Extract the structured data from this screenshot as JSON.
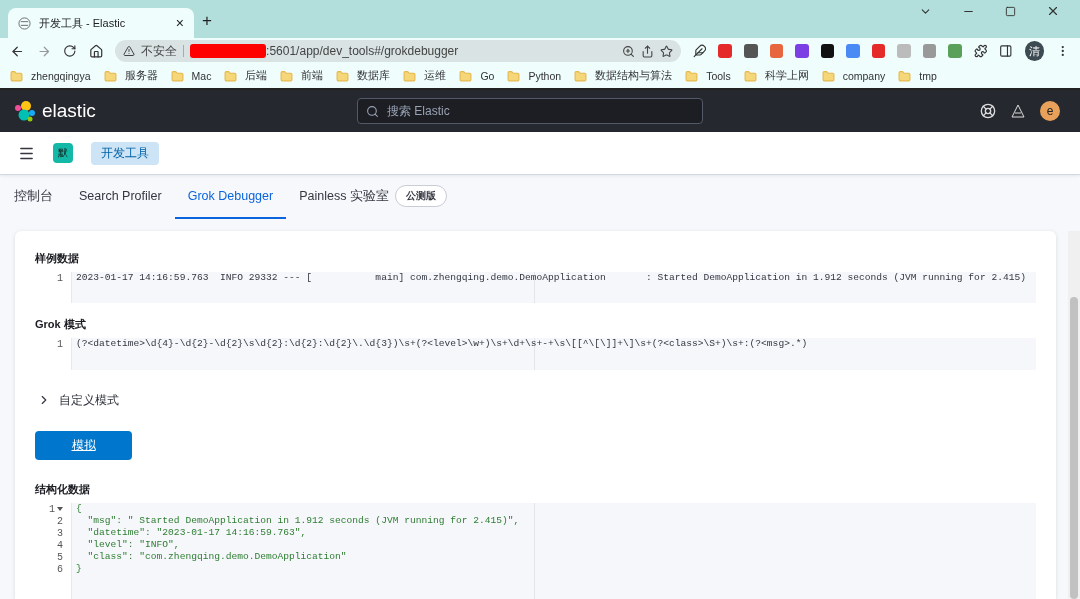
{
  "browser": {
    "tab": {
      "title": "开发工具 - Elastic",
      "close": "×"
    },
    "new_tab": "+",
    "address": {
      "security": "不安全",
      "redacted": true,
      "url": ":5601/app/dev_tools#/grokdebugger"
    },
    "profile": "清",
    "bookmarks": [
      "zhengqingya",
      "服务器",
      "Mac",
      "后端",
      "前端",
      "数据库",
      "运维",
      "Go",
      "Python",
      "数据结构与算法",
      "Tools",
      "科学上网",
      "company",
      "tmp"
    ]
  },
  "header": {
    "logo": "elastic",
    "search": {
      "placeholder": "搜索 Elastic"
    },
    "user": "e"
  },
  "breadcrumbs": {
    "space": "默",
    "items": [
      "开发工具"
    ]
  },
  "tabs": [
    {
      "label": "控制台",
      "selected": false
    },
    {
      "label": "Search Profiler",
      "selected": false
    },
    {
      "label": "Grok Debugger",
      "selected": true
    },
    {
      "label": "Painless 实验室",
      "selected": false,
      "badge": "公测版"
    }
  ],
  "sample_data": {
    "label": "样例数据",
    "lines": [
      {
        "number": "1",
        "text": "2023-01-17 14:16:59.763  INFO 29332 --- [           main] com.zhengqing.demo.DemoApplication       : Started DemoApplication in 1.912 seconds (JVM running for 2.415)"
      }
    ]
  },
  "grok_pattern": {
    "label": "Grok 模式",
    "lines": [
      {
        "number": "1",
        "text": "(?<datetime>\\d{4}-\\d{2}-\\d{2}\\s\\d{2}:\\d{2}:\\d{2}\\.\\d{3})\\s+(?<level>\\w+)\\s+\\d+\\s+-+\\s\\[[^\\[\\]]+\\]\\s+(?<class>\\S+)\\s+:(?<msg>.*)"
      }
    ]
  },
  "custom_patterns": {
    "label": "自定义模式",
    "expanded": false
  },
  "simulate_button": "模拟",
  "structured_data": {
    "label": "结构化数据",
    "lines": [
      {
        "number": "1",
        "text": "{",
        "foldable": true
      },
      {
        "number": "2",
        "text": "  \"msg\": \" Started DemoApplication in 1.912 seconds (JVM running for 2.415)\",",
        "foldable": false
      },
      {
        "number": "3",
        "text": "  \"datetime\": \"2023-01-17 14:16:59.763\",",
        "foldable": false
      },
      {
        "number": "4",
        "text": "  \"level\": \"INFO\",",
        "foldable": false
      },
      {
        "number": "5",
        "text": "  \"class\": \"com.zhengqing.demo.DemoApplication\"",
        "foldable": false
      },
      {
        "number": "6",
        "text": "}",
        "foldable": false
      }
    ]
  }
}
